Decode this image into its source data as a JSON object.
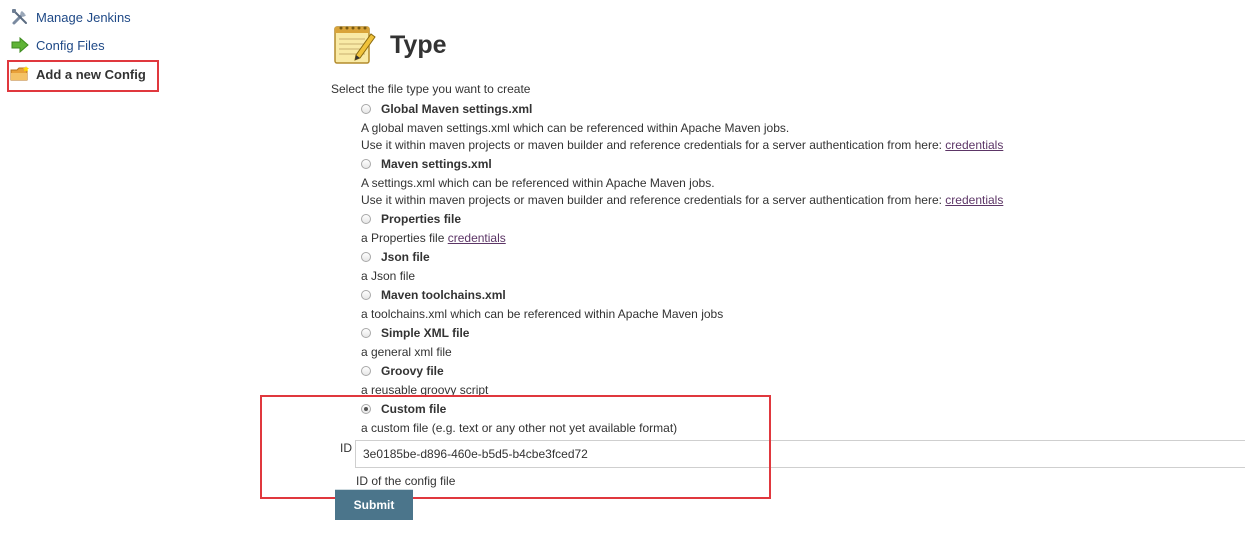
{
  "sidebar": {
    "items": [
      {
        "label": "Manage Jenkins",
        "icon": "tools-icon"
      },
      {
        "label": "Config Files",
        "icon": "green-arrow-icon"
      },
      {
        "label": "Add a new Config",
        "icon": "folder-new-icon"
      }
    ]
  },
  "page": {
    "title": "Type",
    "title_icon": "notepad-icon",
    "prompt": "Select the file type you want to create"
  },
  "options": [
    {
      "label": "Global Maven settings.xml",
      "desc": "A global maven settings.xml which can be referenced within Apache Maven jobs.",
      "desc2_prefix": "Use it within maven projects or maven builder and reference credentials for a server authentication from here: ",
      "link": "credentials",
      "checked": false
    },
    {
      "label": "Maven settings.xml",
      "desc": "A settings.xml which can be referenced within Apache Maven jobs.",
      "desc2_prefix": "Use it within maven projects or maven builder and reference credentials for a server authentication from here: ",
      "link": "credentials",
      "checked": false
    },
    {
      "label": "Properties file",
      "desc_prefix": "a Properties file ",
      "link": "credentials",
      "checked": false
    },
    {
      "label": "Json file",
      "desc": "a Json file",
      "checked": false
    },
    {
      "label": "Maven toolchains.xml",
      "desc": "a toolchains.xml which can be referenced within Apache Maven jobs",
      "checked": false
    },
    {
      "label": "Simple XML file",
      "desc": "a general xml file",
      "checked": false
    },
    {
      "label": "Groovy file",
      "desc": "a reusable groovy script",
      "checked": false
    },
    {
      "label": "Custom file",
      "desc": "a custom file (e.g. text or any other not yet available format)",
      "checked": true
    }
  ],
  "id_field": {
    "label": "ID",
    "value": "3e0185be-d896-460e-b5d5-b4cbe3fced72",
    "help": "ID of the config file"
  },
  "submit_label": "Submit",
  "colors": {
    "link": "#204a87",
    "highlight": "#e0383e",
    "submit_bg": "#4b758b"
  }
}
